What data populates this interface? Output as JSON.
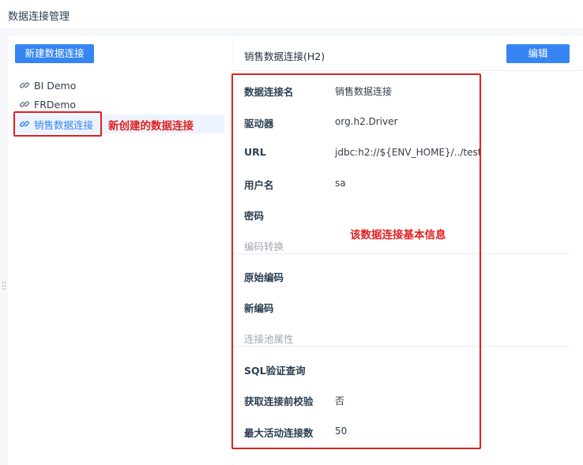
{
  "page_title": "数据连接管理",
  "toolbar": {
    "new_connection_label": "新建数据连接",
    "edit_label": "编辑"
  },
  "connections": [
    {
      "name": "BI Demo",
      "icon": "link-icon"
    },
    {
      "name": "FRDemo",
      "icon": "link-icon"
    },
    {
      "name": "销售数据连接",
      "icon": "link-icon",
      "selected": true
    }
  ],
  "detail": {
    "title": "销售数据连接(H2)",
    "rows": [
      {
        "label": "数据连接名",
        "value": "销售数据连接"
      },
      {
        "label": "驱动器",
        "value": "org.h2.Driver"
      },
      {
        "label": "URL",
        "value": "jdbc:h2://${ENV_HOME}/../test"
      },
      {
        "label": "用户名",
        "value": "sa"
      },
      {
        "label": "密码",
        "value": ""
      }
    ],
    "encoding_section": "编码转换",
    "encoding_rows": [
      {
        "label": "原始编码",
        "value": ""
      },
      {
        "label": "新编码",
        "value": ""
      }
    ],
    "pool_section": "连接池属性",
    "pool_rows": [
      {
        "label": "SQL验证查询",
        "value": ""
      },
      {
        "label": "获取连接前校验",
        "value": "否"
      },
      {
        "label": "最大活动连接数",
        "value": "50"
      }
    ]
  },
  "annotations": {
    "new_connection_note": "新创建的数据连接",
    "basic_info_note": "该数据连接基本信息"
  },
  "colors": {
    "accent": "#3685f2",
    "annotation_red": "#e02020",
    "background": "#f5f7fa"
  }
}
